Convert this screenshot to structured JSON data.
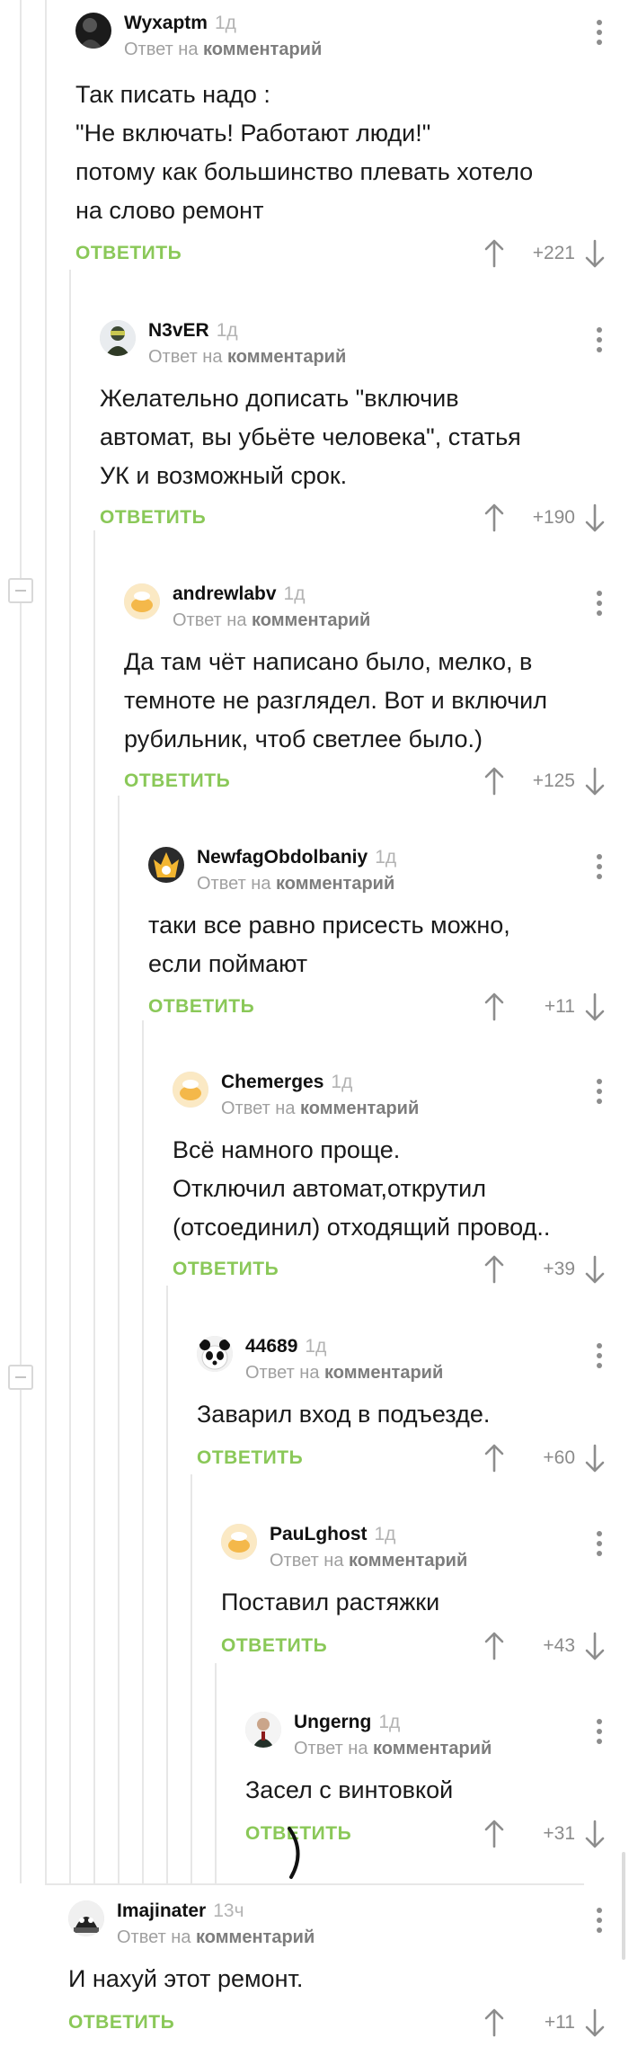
{
  "labels": {
    "reply_to": "Ответ на",
    "comment_link": "комментарий",
    "reply": "ОТВЕТИТЬ"
  },
  "comments": [
    {
      "author": "Wyxaptm",
      "time": "1д",
      "lines": [
        "Так писать надо :",
        "\"Не включать! Работают люди!\"",
        "потому как большинство плевать хотело",
        "на слово ремонт"
      ],
      "rating": "+221"
    },
    {
      "author": "N3vER",
      "time": "1д",
      "lines": [
        "Желательно дописать \"включив",
        "автомат, вы убьёте человека\", статья",
        "УК и возможный срок."
      ],
      "rating": "+190"
    },
    {
      "author": "andrewlabv",
      "time": "1д",
      "lines": [
        "Да там чёт написано было, мелко, в",
        "темноте не разглядел. Вот и включил",
        "рубильник, чтоб светлее было.)"
      ],
      "rating": "+125"
    },
    {
      "author": "NewfagObdolbaniy",
      "time": "1д",
      "lines": [
        "таки все равно присесть можно,",
        "если поймают"
      ],
      "rating": "+11"
    },
    {
      "author": "Chemerges",
      "time": "1д",
      "lines": [
        "Всё намного проще.",
        "Отключил автомат,открутил",
        "(отсоединил) отходящий провод.."
      ],
      "rating": "+39"
    },
    {
      "author": "44689",
      "time": "1д",
      "lines": [
        "Заварил вход в подъезде."
      ],
      "rating": "+60"
    },
    {
      "author": "PauLghost",
      "time": "1д",
      "lines": [
        "Поставил растяжки"
      ],
      "rating": "+43"
    },
    {
      "author": "Ungerng",
      "time": "1д",
      "lines": [
        "Засел с винтовкой"
      ],
      "rating": "+31"
    },
    {
      "author": "Imajinater",
      "time": "13ч",
      "lines": [
        "И нахуй этот ремонт."
      ],
      "rating": "+11"
    }
  ],
  "colors": {
    "reply_accent": "#8ac858",
    "meta_text": "#a0a0a0",
    "thread_line": "#e7e7e7"
  }
}
